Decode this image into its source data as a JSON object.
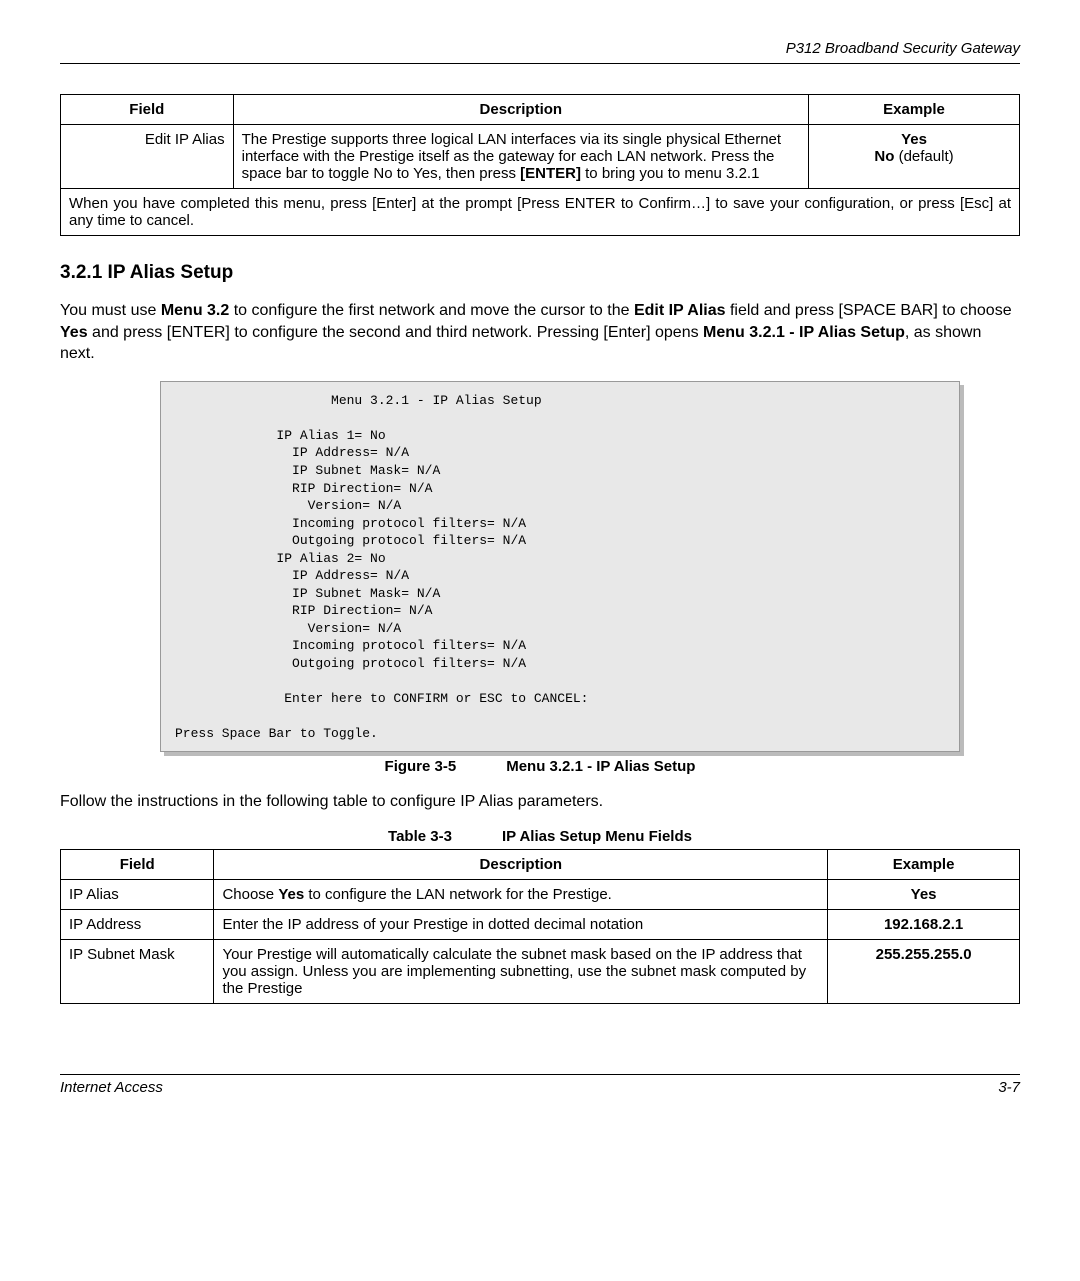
{
  "header": {
    "product": "P312  Broadband Security Gateway"
  },
  "table1": {
    "headers": {
      "field": "Field",
      "desc": "Description",
      "example": "Example"
    },
    "row": {
      "field": "Edit IP Alias",
      "desc_pre": "The Prestige supports three logical LAN interfaces via its single physical Ethernet interface with the Prestige itself as the gateway for each LAN network. Press the space bar to toggle No to Yes, then press ",
      "desc_bold": "[ENTER]",
      "desc_post": " to bring you to menu 3.2.1",
      "example_yes": "Yes",
      "example_no": "No",
      "example_default": " (default)"
    },
    "note": "When you have completed this menu, press [Enter] at the prompt [Press ENTER to Confirm…] to save your configuration, or press [Esc] at any time to cancel."
  },
  "section": {
    "heading": "3.2.1  IP Alias Setup",
    "p1_a": "You must use ",
    "p1_b": "Menu 3.2",
    "p1_c": " to configure the first network and move the cursor to the ",
    "p1_d": "Edit IP Alias",
    "p1_e": " field and press [SPACE BAR] to choose ",
    "p1_f": "Yes",
    "p1_g": " and press [ENTER] to configure the second and third network. Pressing [Enter] opens ",
    "p1_h": "Menu 3.2.1 - IP Alias Setup",
    "p1_i": ", as shown next."
  },
  "terminal": "                    Menu 3.2.1 - IP Alias Setup\n\n             IP Alias 1= No\n               IP Address= N/A\n               IP Subnet Mask= N/A\n               RIP Direction= N/A\n                 Version= N/A\n               Incoming protocol filters= N/A\n               Outgoing protocol filters= N/A\n             IP Alias 2= No\n               IP Address= N/A\n               IP Subnet Mask= N/A\n               RIP Direction= N/A\n                 Version= N/A\n               Incoming protocol filters= N/A\n               Outgoing protocol filters= N/A\n\n              Enter here to CONFIRM or ESC to CANCEL:\n\nPress Space Bar to Toggle.",
  "figure": {
    "num": "Figure 3-5",
    "title": "Menu 3.2.1 - IP Alias Setup"
  },
  "follow_text": "Follow the instructions in the following table to configure IP Alias parameters.",
  "table_caption": {
    "num": "Table 3-3",
    "title": "IP Alias Setup Menu Fields"
  },
  "table2": {
    "headers": {
      "field": "Field",
      "desc": "Description",
      "example": "Example"
    },
    "rows": [
      {
        "field": "IP Alias",
        "desc_pre": "Choose ",
        "desc_bold": "Yes",
        "desc_post": " to configure the LAN network for the Prestige.",
        "example": "Yes"
      },
      {
        "field": "IP Address",
        "desc_pre": "Enter the IP address of your Prestige in dotted decimal notation",
        "desc_bold": "",
        "desc_post": "",
        "example": "192.168.2.1"
      },
      {
        "field": "IP Subnet Mask",
        "desc_pre": "Your Prestige will automatically calculate the subnet mask based on the IP address that you assign. Unless you are implementing subnetting, use the subnet mask computed by the Prestige",
        "desc_bold": "",
        "desc_post": "",
        "example": "255.255.255.0"
      }
    ]
  },
  "footer": {
    "left": "Internet Access",
    "right": "3-7"
  }
}
